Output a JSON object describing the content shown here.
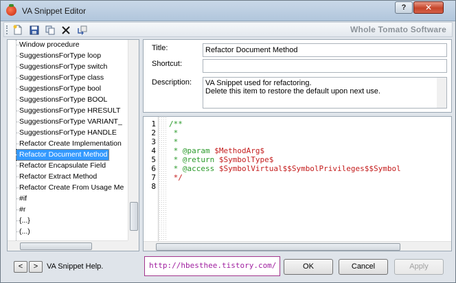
{
  "window": {
    "title": "VA Snippet Editor",
    "help_label": "?",
    "close_label": "✕"
  },
  "toolbar": {
    "buttons": [
      "new-snippet-icon",
      "save-icon",
      "copy-icon",
      "delete-icon",
      "insert-icon"
    ],
    "brand": "Whole Tomato Software"
  },
  "list": {
    "items": [
      "Window procedure",
      "SuggestionsForType loop",
      "SuggestionsForType switch",
      "SuggestionsForType class",
      "SuggestionsForType bool",
      "SuggestionsForType BOOL",
      "SuggestionsForType HRESULT",
      "SuggestionsForType VARIANT_",
      "SuggestionsForType HANDLE",
      "Refactor Create Implementation",
      "Refactor Document Method",
      "Refactor Encapsulate Field",
      "Refactor Extract Method",
      "Refactor Create From Usage Me",
      "#if",
      "#r",
      "{...}",
      "(...)"
    ],
    "selected_index": 10
  },
  "fields": {
    "title_label": "Title:",
    "title_value": "Refactor Document Method",
    "shortcut_label": "Shortcut:",
    "shortcut_value": "",
    "description_label": "Description:",
    "description_lines": [
      "VA Snippet used for refactoring.",
      "Delete this item to restore the default upon next use."
    ]
  },
  "code": {
    "line_numbers": [
      "1",
      "2",
      "3",
      "4",
      "5",
      "6",
      "7",
      "8"
    ],
    "lines": [
      [
        {
          "t": "/**",
          "c": "green"
        }
      ],
      [
        {
          "t": " *",
          "c": "green"
        }
      ],
      [
        {
          "t": " *",
          "c": "green"
        }
      ],
      [
        {
          "t": " * @param ",
          "c": "green"
        },
        {
          "t": "$MethodArg$",
          "c": "red"
        }
      ],
      [
        {
          "t": " * @return ",
          "c": "green"
        },
        {
          "t": "$SymbolType$",
          "c": "red"
        }
      ],
      [
        {
          "t": " * @access ",
          "c": "green"
        },
        {
          "t": "$SymbolVirtual$$SymbolPrivileges$$Symbol",
          "c": "red"
        }
      ],
      [
        {
          "t": " */",
          "c": "red"
        }
      ],
      [
        {
          "t": "",
          "c": "green"
        }
      ]
    ]
  },
  "bottom": {
    "prev_label": "<",
    "next_label": ">",
    "help_text": "VA Snippet Help.",
    "url": "http://hbesthee.tistory.com/",
    "ok_label": "OK",
    "cancel_label": "Cancel",
    "apply_label": "Apply"
  }
}
